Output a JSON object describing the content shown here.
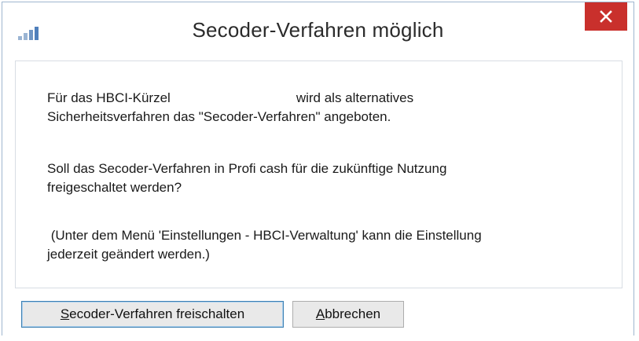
{
  "window": {
    "title": "Secoder-Verfahren möglich",
    "icon": "bar-chart-icon",
    "close_icon": "close-icon",
    "close_color": "#c9302c"
  },
  "message": {
    "p1_line1_a": "Für das HBCI-Kürzel",
    "p1_line1_b": "wird als alternatives",
    "p1_line2": "Sicherheitsverfahren  das \"Secoder-Verfahren\" angeboten.",
    "p2_line1": "Soll das Secoder-Verfahren in Profi cash für die zukünftige Nutzung",
    "p2_line2": "freigeschaltet werden?",
    "p3_line1": " (Unter dem Menü 'Einstellungen - HBCI-Verwaltung' kann die Einstellung",
    "p3_line2": "jederzeit geändert werden.)"
  },
  "buttons": {
    "enable_mnemonic": "S",
    "enable_rest": "ecoder-Verfahren freischalten",
    "cancel_mnemonic": "A",
    "cancel_rest": "bbrechen"
  }
}
